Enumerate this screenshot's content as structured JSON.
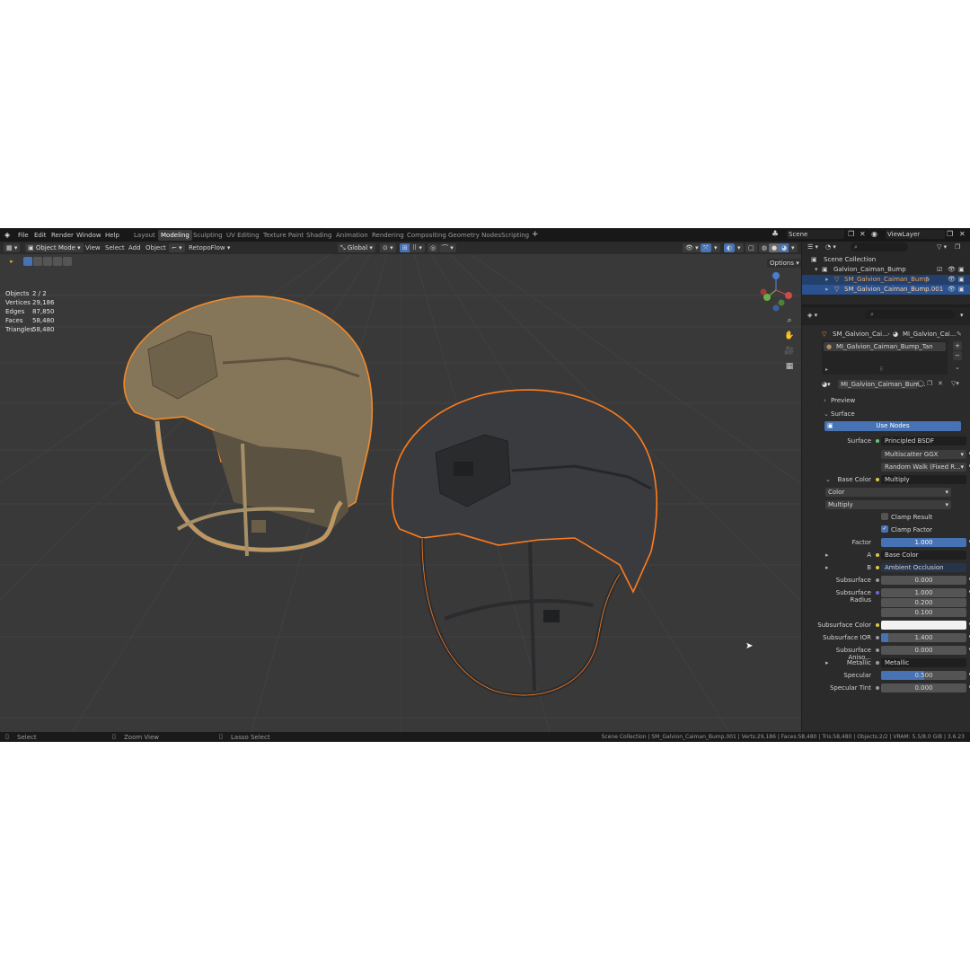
{
  "menu": [
    "File",
    "Edit",
    "Render",
    "Window",
    "Help"
  ],
  "workspaces": [
    "Layout",
    "Modeling",
    "Sculpting",
    "UV Editing",
    "Texture Paint",
    "Shading",
    "Animation",
    "Rendering",
    "Compositing",
    "Geometry Nodes",
    "Scripting"
  ],
  "active_workspace": "Modeling",
  "scene_name": "Scene",
  "view_layer": "ViewLayer",
  "viewport": {
    "mode": "Object Mode",
    "menus": [
      "View",
      "Select",
      "Add",
      "Object"
    ],
    "addon": "RetopoFlow",
    "orientation": "Global",
    "options_label": "Options",
    "stats": [
      {
        "label": "Objects",
        "value": "2 / 2"
      },
      {
        "label": "Vertices",
        "value": "29,186"
      },
      {
        "label": "Edges",
        "value": "87,850"
      },
      {
        "label": "Faces",
        "value": "58,480"
      },
      {
        "label": "Triangles",
        "value": "58,480"
      }
    ]
  },
  "outliner": {
    "root": "Scene Collection",
    "collection": "Galvion_Caiman_Bump",
    "objects": [
      "SM_Galvion_Caiman_Bump",
      "SM_Galvion_Caiman_Bump.001"
    ]
  },
  "properties": {
    "breadcrumb_object": "SM_Galvion_Cai...",
    "breadcrumb_material": "MI_Galvion_Cai...",
    "material_slot": "MI_Galvion_Caiman_Bump_Tan",
    "material_name": "MI_Galvion_Caiman_Bum...",
    "preview_label": "Preview",
    "surface_panel": "Surface",
    "use_nodes": "Use Nodes",
    "surface_label": "Surface",
    "surface_value": "Principled BSDF",
    "distribution": "Multiscatter GGX",
    "subsurface_method": "Random Walk (Fixed R...",
    "base_color_label": "Base Color",
    "base_color_value": "Multiply",
    "color_dropdown": "Color",
    "blend_dropdown": "Multiply",
    "clamp_result": "Clamp Result",
    "clamp_factor": "Clamp Factor",
    "factor_label": "Factor",
    "factor_value": "1.000",
    "a_label": "A",
    "a_value": "Base Color",
    "b_label": "B",
    "b_value": "Ambient Occlusion",
    "subsurface_label": "Subsurface",
    "subsurface_value": "0.000",
    "subsurface_radius_label": "Subsurface Radius",
    "subsurface_radius": [
      "1.000",
      "0.200",
      "0.100"
    ],
    "subsurface_color_label": "Subsurface Color",
    "subsurface_ior_label": "Subsurface IOR",
    "subsurface_ior_value": "1.400",
    "subsurface_aniso_label": "Subsurface Aniso...",
    "subsurface_aniso_value": "0.000",
    "metallic_label": "Metallic",
    "metallic_value": "Metallic",
    "specular_label": "Specular",
    "specular_value": "0.500",
    "specular_tint_label": "Specular Tint",
    "specular_tint_value": "0.000"
  },
  "status": {
    "select": "Select",
    "zoom": "Zoom View",
    "lasso": "Lasso Select",
    "info": "Scene Collection | SM_Galvion_Caiman_Bump.001 | Verts:29,186 | Faces:58,480 | Tris:58,480 | Objects:2/2 | VRAM: 5.5/8.0 GiB | 3.6.23"
  },
  "colors": {
    "accent_blue": "#4772b3",
    "selection_orange": "#f08a2a",
    "active_orange": "#ff7b1c",
    "tan_helmet": "#8a7a5c",
    "dark_helmet": "#3a3b3e"
  }
}
